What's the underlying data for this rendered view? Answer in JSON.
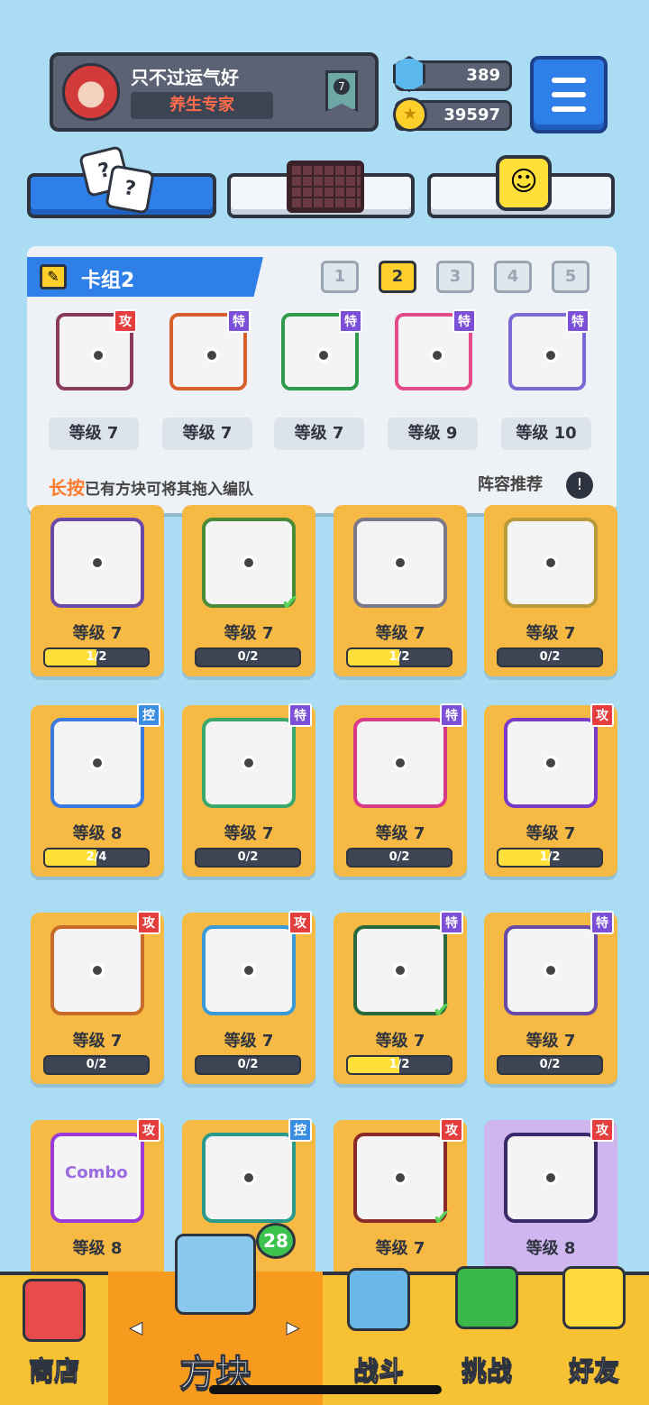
{
  "profile": {
    "name": "只不过运气好",
    "title": "养生专家",
    "rank": "7"
  },
  "currency": {
    "gems": "389",
    "coins": "39597"
  },
  "top_tabs": [
    "dice-icon",
    "board-icon",
    "emote-icon"
  ],
  "dice_face": "?",
  "deck": {
    "name": "卡组2",
    "numbers": [
      "1",
      "2",
      "3",
      "4",
      "5"
    ],
    "active_index": 1,
    "cards": [
      {
        "type": "攻",
        "level": "等级 7",
        "color": "#8a3a5a"
      },
      {
        "type": "特",
        "level": "等级 7",
        "color": "#d8602c"
      },
      {
        "type": "特",
        "level": "等级 7",
        "color": "#2f9a4a"
      },
      {
        "type": "特",
        "level": "等级 9",
        "color": "#e54a8a"
      },
      {
        "type": "特",
        "level": "等级 10",
        "color": "#7b6ad6"
      }
    ],
    "hint_highlight": "长按",
    "hint_rest": "已有方块可将其拖入编队",
    "recommend": "阵容推荐",
    "recommend_icon": "!"
  },
  "collection": [
    {
      "type": "",
      "level": "等级 7",
      "progress": "1/2",
      "fill": 0.5,
      "color": "#6a4aa8",
      "checked": false
    },
    {
      "type": "",
      "level": "等级 7",
      "progress": "0/2",
      "fill": 0,
      "color": "#4a8a3a",
      "checked": true
    },
    {
      "type": "",
      "level": "等级 7",
      "progress": "1/2",
      "fill": 0.5,
      "color": "#7a7a8a",
      "checked": false
    },
    {
      "type": "",
      "level": "等级 7",
      "progress": "0/2",
      "fill": 0,
      "color": "#b89a3a",
      "checked": false
    },
    {
      "type": "控",
      "level": "等级 8",
      "progress": "2/4",
      "fill": 0.5,
      "color": "#3a7ae0",
      "checked": false
    },
    {
      "type": "特",
      "level": "等级 7",
      "progress": "0/2",
      "fill": 0,
      "color": "#3aa86a",
      "checked": false
    },
    {
      "type": "特",
      "level": "等级 7",
      "progress": "0/2",
      "fill": 0,
      "color": "#d83a8a",
      "checked": false
    },
    {
      "type": "攻",
      "level": "等级 7",
      "progress": "1/2",
      "fill": 0.5,
      "color": "#7a3ac8",
      "checked": false
    },
    {
      "type": "攻",
      "level": "等级 7",
      "progress": "0/2",
      "fill": 0,
      "color": "#c86a2a",
      "checked": false
    },
    {
      "type": "攻",
      "level": "等级 7",
      "progress": "0/2",
      "fill": 0,
      "color": "#3a9ad8",
      "checked": false
    },
    {
      "type": "特",
      "level": "等级 7",
      "progress": "1/2",
      "fill": 0.5,
      "color": "#2a6a3a",
      "checked": true
    },
    {
      "type": "特",
      "level": "等级 7",
      "progress": "0/2",
      "fill": 0,
      "color": "#6a4aa8",
      "checked": false
    },
    {
      "type": "攻",
      "level": "等级 8",
      "progress": "",
      "fill": 0,
      "color": "#9a3ad8",
      "checked": false
    },
    {
      "type": "控",
      "level": "",
      "progress": "",
      "fill": 0,
      "color": "#2a9a8a",
      "checked": false
    },
    {
      "type": "攻",
      "level": "等级 7",
      "progress": "",
      "fill": 0,
      "color": "#8a2a2a",
      "checked": true
    },
    {
      "type": "攻",
      "level": "等级 8",
      "progress": "",
      "fill": 0,
      "color": "#3a2a6a",
      "checked": false
    }
  ],
  "collection_card_text": "Combo",
  "bottom_nav": [
    {
      "label": "商店",
      "icon": "shop-icon"
    },
    {
      "label": "方块",
      "icon": "cube-icon"
    },
    {
      "label": "战斗",
      "icon": "battle-icon"
    },
    {
      "label": "挑战",
      "icon": "challenge-icon"
    },
    {
      "label": "好友",
      "icon": "friends-icon"
    }
  ],
  "cube_badge": "28",
  "arrows": {
    "left": "◀",
    "right": "▶"
  },
  "colors": {
    "accent_blue": "#2f7fe8",
    "gold": "#f6b943",
    "nav": "#f6c133",
    "attack_badge": "#e53e3e",
    "special_badge": "#7b4fd6",
    "control_badge": "#3a8de0"
  }
}
